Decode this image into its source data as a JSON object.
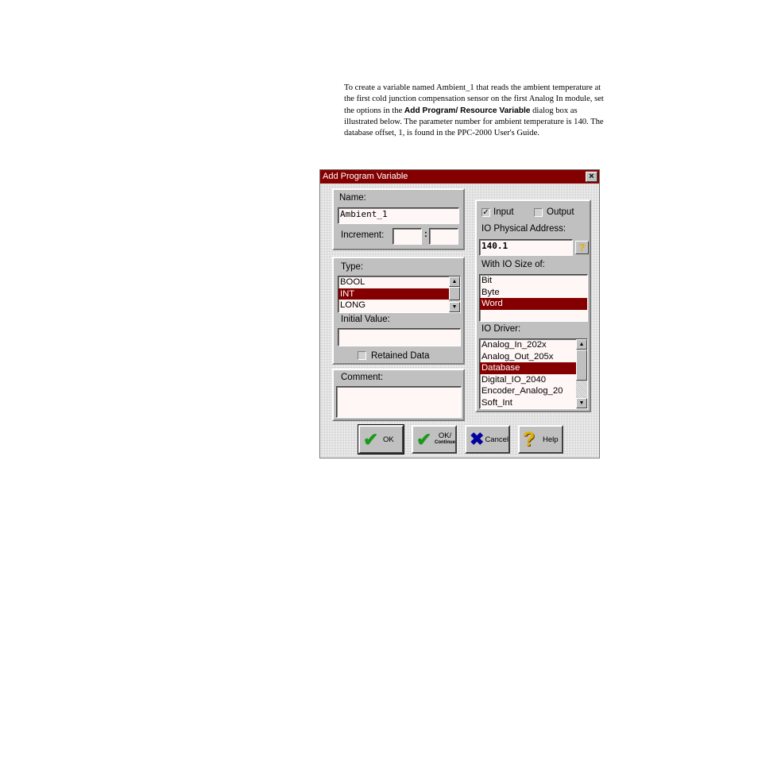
{
  "doc": {
    "p1": "To create a variable named Ambient_1 that reads the ambient temperature at the first cold junction compensation sensor on the first Analog In module, set the options in the ",
    "bold": "Add Program/ Resource Variable",
    "p2": " dialog box as illustrated below. The parameter number for ambient temperature is 140. The database offset, 1, is found in the PPC-2000 User's Guide."
  },
  "dialog": {
    "title": "Add Program Variable",
    "close": "×",
    "name_label": "Name:",
    "name_value": "Ambient_1",
    "increment_label": "Increment:",
    "increment_sep": ":",
    "increment_a": "",
    "increment_b": "",
    "type_label": "Type:",
    "types": [
      "BOOL",
      "INT",
      "LONG"
    ],
    "type_selected": "INT",
    "initial_value_label": "Initial Value:",
    "initial_value": "",
    "retained_label": "Retained Data",
    "comment_label": "Comment:",
    "comment_value": "",
    "input_label": "Input",
    "input_checked": true,
    "output_label": "Output",
    "output_checked": false,
    "address_label": "IO Physical Address:",
    "address_value": "140.1",
    "address_help": "?",
    "size_label": "With IO Size of:",
    "sizes": [
      "Bit",
      "Byte",
      "Word"
    ],
    "size_selected": "Word",
    "driver_label": "IO Driver:",
    "drivers": [
      "Analog_In_202x",
      "Analog_Out_205x",
      "Database",
      "Digital_IO_2040",
      "Encoder_Analog_20",
      "Soft_Int"
    ],
    "driver_selected": "Database",
    "buttons": {
      "ok": "OK",
      "ok_continue_1": "OK/",
      "ok_continue_2": "Continue",
      "cancel": "Cancel",
      "help": "Help"
    },
    "colors": {
      "titlebar": "#840000",
      "selection": "#840000",
      "ok_check": "#1a9a1a",
      "cancel_x": "#0000a0",
      "help_q": "#e0b000"
    },
    "icons": {
      "ok": "green-check-icon",
      "ok_continue": "green-check-icon",
      "cancel": "blue-x-icon",
      "help": "yellow-question-icon"
    }
  }
}
